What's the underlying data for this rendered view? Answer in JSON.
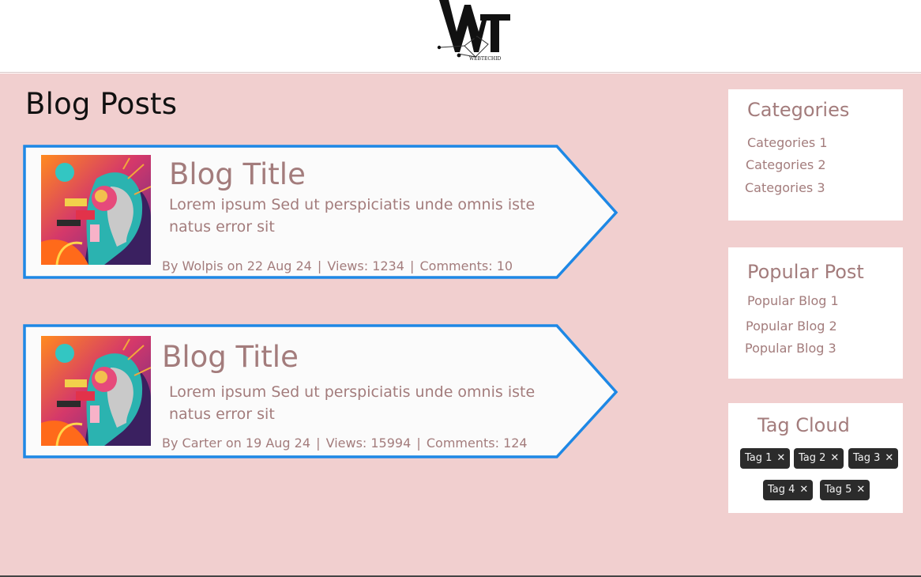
{
  "header": {
    "logo_letters": "WT",
    "logo_subtext": "WEBTECHID"
  },
  "page": {
    "title": "Blog Posts"
  },
  "posts": [
    {
      "title": "Blog Title",
      "excerpt": "Lorem ipsum  Sed ut perspiciatis unde omnis iste natus error sit",
      "author_line": "By Wolpis on 22 Aug 24",
      "views": "Views: 1234",
      "comments": "Comments: 10"
    },
    {
      "title": "Blog Title",
      "excerpt": "Lorem ipsum  Sed ut perspiciatis unde omnis iste natus error sit",
      "author_line": "By Carter on 19 Aug 24",
      "views": "Views: 15994",
      "comments": "Comments: 124"
    }
  ],
  "sidebar": {
    "categories": {
      "title": "Categories",
      "items": [
        "Categories 1",
        "Categories 2",
        "Categories 3"
      ]
    },
    "popular": {
      "title": "Popular Post",
      "items": [
        "Popular Blog 1",
        "Popular Blog 2",
        "Popular Blog 3"
      ]
    },
    "tags": {
      "title": "Tag Cloud",
      "items": [
        "Tag 1",
        "Tag 2",
        "Tag 3",
        "Tag 4",
        "Tag 5"
      ],
      "remove_glyph": "✕"
    }
  },
  "colors": {
    "page_bg": "#f1cfcf",
    "card_border": "#1e88e5",
    "text_accent": "#a37c7c",
    "tag_bg": "#2b2b2b"
  },
  "icons": {
    "logo": "wt-logo-icon",
    "tag_remove": "close-icon"
  }
}
